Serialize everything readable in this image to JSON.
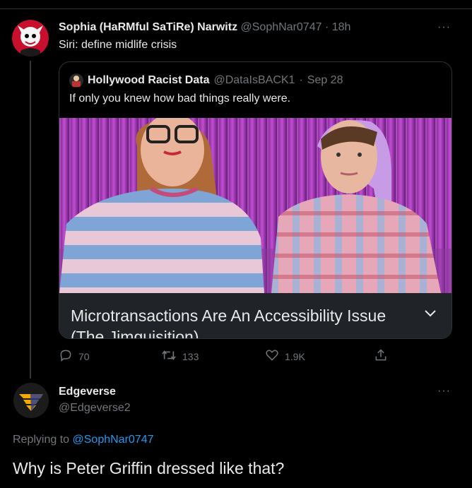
{
  "tweet": {
    "author_name": "Sophia (HaRMful SaTiRe) Narwitz",
    "author_handle": "@SophNar0747",
    "separator": "·",
    "time": "18h",
    "text": "Siri: define midlife crisis",
    "more_label": "···",
    "quote": {
      "author_name": "Hollywood Racist Data",
      "author_handle": "@DataIsBACK1",
      "separator": "·",
      "date": "Sep 28",
      "text": "If only you knew how bad things really were.",
      "media_caption": "Microtransactions Are An Accessibility Issue (The Jimquisition)"
    },
    "actions": {
      "replies": "70",
      "retweets": "133",
      "likes": "1.9K"
    }
  },
  "reply": {
    "author_name": "Edgeverse",
    "author_handle": "@Edgeverse2",
    "more_label": "···",
    "replying_prefix": "Replying to",
    "replying_to": "@SophNar0747",
    "text": "Why is Peter Griffin dressed like that?"
  },
  "colors": {
    "background": "#000000",
    "text_primary": "#e7e9ea",
    "text_secondary": "#71767b",
    "link": "#1d9bf0",
    "border": "#2f3336"
  }
}
